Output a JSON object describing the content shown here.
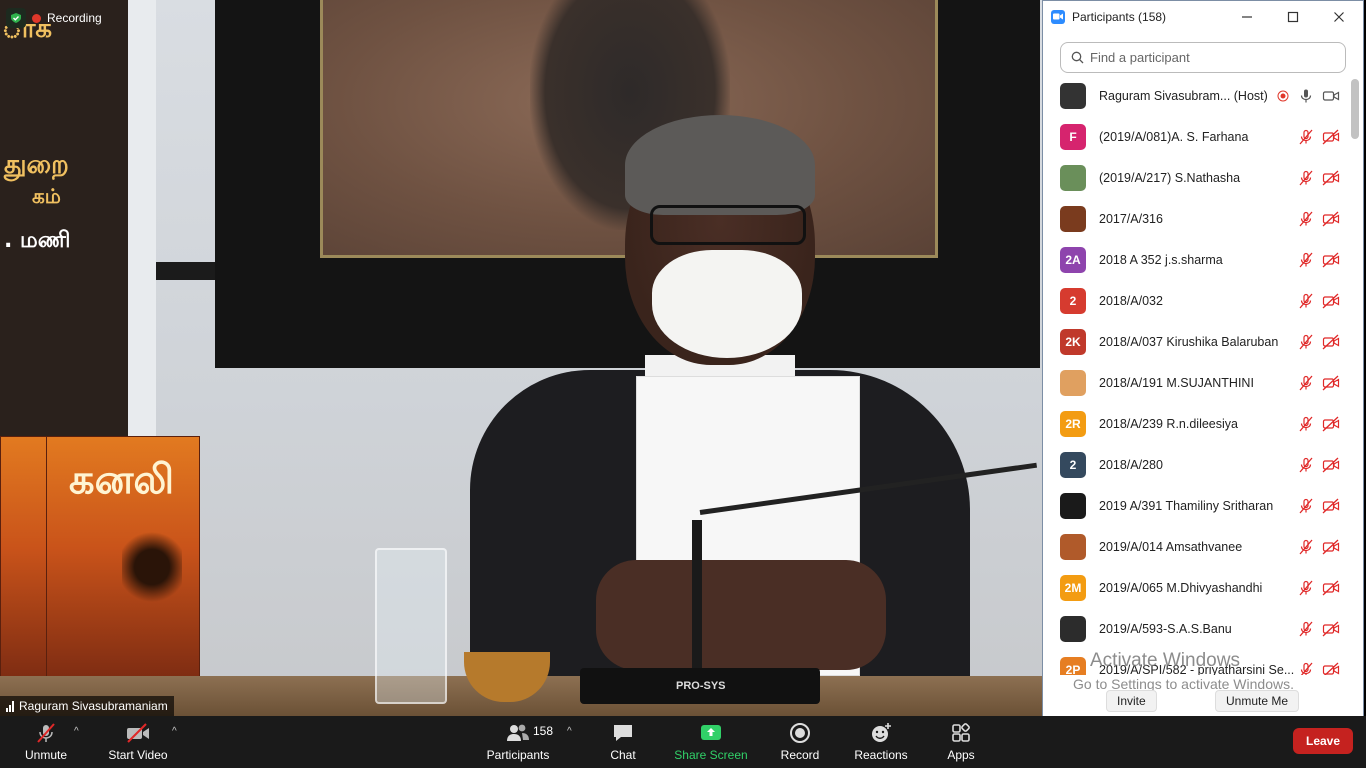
{
  "window": {
    "title": "Participants (158)"
  },
  "stage": {
    "recording_label": "Recording",
    "speaker_name": "Raguram Sivasubramaniam",
    "book_title": "கனலி",
    "banner_lines": [
      "துறை",
      "கம்",
      "மணி"
    ],
    "mic_brand": "PRO-SYS"
  },
  "panel": {
    "search_placeholder": "Find a participant",
    "participants": [
      {
        "name": "Raguram Sivasubram... (Host)",
        "avatar": "",
        "color": "#333333",
        "muted": false
      },
      {
        "name": "(2019/A/081)A. S. Farhana",
        "avatar": "F",
        "color": "#d6246e",
        "muted": true
      },
      {
        "name": "(2019/A/217) S.Nathasha",
        "avatar": "",
        "color": "#6a8f5a",
        "muted": true
      },
      {
        "name": "2017/A/316",
        "avatar": "",
        "color": "#7a3b1e",
        "muted": true
      },
      {
        "name": "2018 A 352 j.s.sharma",
        "avatar": "2A",
        "color": "#8e44ad",
        "muted": true
      },
      {
        "name": "2018/A/032",
        "avatar": "2",
        "color": "#d63b2f",
        "muted": true
      },
      {
        "name": "2018/A/037 Kirushika Balaruban",
        "avatar": "2K",
        "color": "#c0392b",
        "muted": true
      },
      {
        "name": "2018/A/191 M.SUJANTHINI",
        "avatar": "",
        "color": "#e0a060",
        "muted": true
      },
      {
        "name": "2018/A/239 R.n.dileesiya",
        "avatar": "2R",
        "color": "#f39c12",
        "muted": true
      },
      {
        "name": "2018/A/280",
        "avatar": "2",
        "color": "#34495e",
        "muted": true
      },
      {
        "name": "2019 A/391 Thamiliny Sritharan",
        "avatar": "",
        "color": "#1a1a1a",
        "muted": true
      },
      {
        "name": "2019/A/014 Amsathvanee",
        "avatar": "",
        "color": "#b05a2a",
        "muted": true
      },
      {
        "name": "2019/A/065 M.Dhivyashandhi",
        "avatar": "2M",
        "color": "#f39c12",
        "muted": true
      },
      {
        "name": "2019/A/593-S.A.S.Banu",
        "avatar": "",
        "color": "#2c2c2c",
        "muted": true
      },
      {
        "name": "2019/A/SPI/582 - priyatharsini Se...",
        "avatar": "2P",
        "color": "#e67e22",
        "muted": true
      }
    ],
    "invite_label": "Invite",
    "unmute_me_label": "Unmute Me",
    "watermark_title": "Activate Windows",
    "watermark_sub": "Go to Settings to activate Windows."
  },
  "toolbar": {
    "unmute": "Unmute",
    "start_video": "Start Video",
    "participants": "Participants",
    "participant_count": "158",
    "chat": "Chat",
    "share_screen": "Share Screen",
    "record": "Record",
    "reactions": "Reactions",
    "apps": "Apps",
    "leave": "Leave"
  },
  "colors": {
    "leave": "#c5221f",
    "share": "#31d068",
    "muted_icon": "#e02828",
    "zoom_blue": "#2d8cff"
  }
}
